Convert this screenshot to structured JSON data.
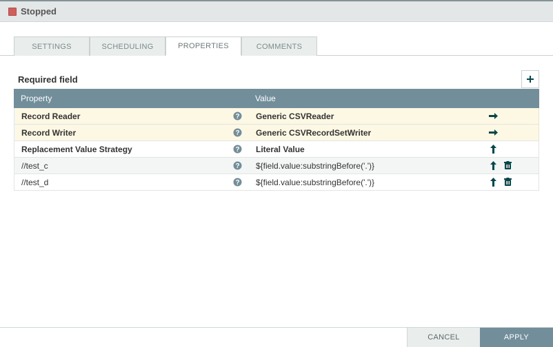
{
  "status": {
    "label": "Stopped"
  },
  "tabs": {
    "settings": "SETTINGS",
    "scheduling": "SCHEDULING",
    "properties": "PROPERTIES",
    "comments": "COMMENTS"
  },
  "section": {
    "title": "Required field"
  },
  "columns": {
    "property": "Property",
    "value": "Value"
  },
  "rows": [
    {
      "property": "Record Reader",
      "value": "Generic CSVReader",
      "required": true,
      "dynamic": false,
      "goto": true,
      "trash": false
    },
    {
      "property": "Record Writer",
      "value": "Generic CSVRecordSetWriter",
      "required": true,
      "dynamic": false,
      "goto": true,
      "trash": false
    },
    {
      "property": "Replacement Value Strategy",
      "value": "Literal Value",
      "required": false,
      "dynamic": false,
      "goto": false,
      "trash": false
    },
    {
      "property": "//test_c",
      "value": "${field.value:substringBefore('.')}",
      "required": false,
      "dynamic": true,
      "goto": false,
      "trash": true
    },
    {
      "property": "//test_d",
      "value": "${field.value:substringBefore('.')}",
      "required": false,
      "dynamic": true,
      "goto": false,
      "trash": true
    }
  ],
  "buttons": {
    "cancel": "CANCEL",
    "apply": "APPLY"
  }
}
